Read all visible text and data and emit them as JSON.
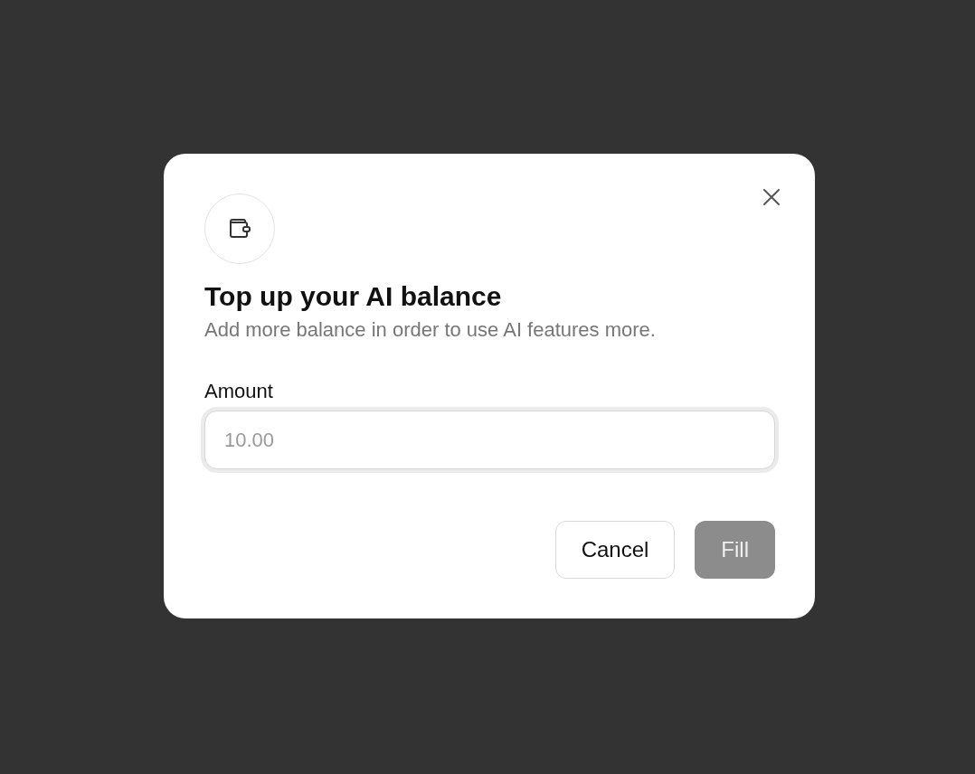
{
  "dialog": {
    "title": "Top up your AI balance",
    "description": "Add more balance in order to use AI features more.",
    "field": {
      "label": "Amount",
      "placeholder": "10.00"
    },
    "buttons": [
      {
        "label": "Cancel",
        "kind": "secondary",
        "disabled": false
      },
      {
        "label": "Fill",
        "kind": "primary",
        "disabled": true
      }
    ]
  }
}
